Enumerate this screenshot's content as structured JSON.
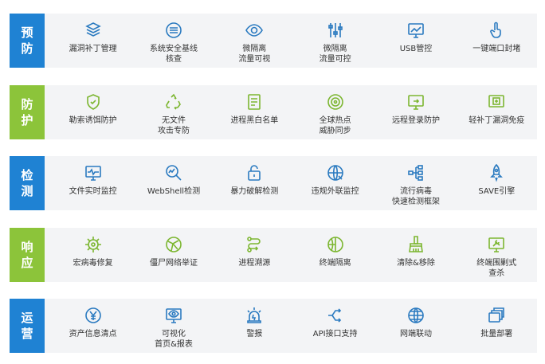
{
  "colors": {
    "blue": "#1f82d3",
    "green": "#8cc43a",
    "icon_blue": "#2a7ac0",
    "icon_green": "#7cb630",
    "text": "#333333"
  },
  "rows": [
    {
      "label": [
        "预",
        "防"
      ],
      "items": [
        {
          "icon": "layers-shield-icon",
          "lines": [
            "漏洞补丁管理"
          ]
        },
        {
          "icon": "server-list-icon",
          "lines": [
            "系统安全基线",
            "核查"
          ]
        },
        {
          "icon": "eye-icon",
          "lines": [
            "微隔离",
            "流量可视"
          ]
        },
        {
          "icon": "sliders-icon",
          "lines": [
            "微隔离",
            "流量可控"
          ]
        },
        {
          "icon": "monitor-chart-icon",
          "lines": [
            "USB管控"
          ]
        },
        {
          "icon": "hand-pointer-icon",
          "lines": [
            "一键端口封堵"
          ]
        }
      ]
    },
    {
      "label": [
        "防",
        "护"
      ],
      "items": [
        {
          "icon": "shield-check-icon",
          "lines": [
            "勒索诱饵防护"
          ]
        },
        {
          "icon": "recycle-icon",
          "lines": [
            "无文件",
            "攻击专防"
          ]
        },
        {
          "icon": "document-list-icon",
          "lines": [
            "进程黑白名单"
          ]
        },
        {
          "icon": "globe-target-icon",
          "lines": [
            "全球热点",
            "威胁同步"
          ]
        },
        {
          "icon": "remote-monitor-icon",
          "lines": [
            "远程登录防护"
          ]
        },
        {
          "icon": "patch-screen-icon",
          "lines": [
            "轻补丁漏洞免疫"
          ]
        }
      ]
    },
    {
      "label": [
        "检",
        "测"
      ],
      "items": [
        {
          "icon": "monitor-pulse-icon",
          "lines": [
            "文件实时监控"
          ]
        },
        {
          "icon": "search-chart-icon",
          "lines": [
            "WebShell检测"
          ]
        },
        {
          "icon": "padlock-icon",
          "lines": [
            "暴力破解检测"
          ]
        },
        {
          "icon": "globe-arrow-icon",
          "lines": [
            "违规外联监控"
          ]
        },
        {
          "icon": "network-tree-icon",
          "lines": [
            "流行病毒",
            "快速检测框架"
          ]
        },
        {
          "icon": "rocket-icon",
          "lines": [
            "SAVE引擎"
          ]
        }
      ]
    },
    {
      "label": [
        "响",
        "应"
      ],
      "items": [
        {
          "icon": "gear-bug-icon",
          "lines": [
            "宏病毒修复"
          ]
        },
        {
          "icon": "globe-network-icon",
          "lines": [
            "僵尸网络举证"
          ]
        },
        {
          "icon": "process-trace-icon",
          "lines": [
            "进程溯源"
          ]
        },
        {
          "icon": "globe-isolate-icon",
          "lines": [
            "终端隔离"
          ]
        },
        {
          "icon": "broom-icon",
          "lines": [
            "清除&移除"
          ]
        },
        {
          "icon": "monitor-tools-icon",
          "lines": [
            "终端围剿式",
            "查杀"
          ]
        }
      ]
    },
    {
      "label": [
        "运",
        "营"
      ],
      "items": [
        {
          "icon": "yen-coin-icon",
          "lines": [
            "资产信息清点"
          ]
        },
        {
          "icon": "monitor-eye-icon",
          "lines": [
            "可视化",
            "首页&报表"
          ]
        },
        {
          "icon": "alarm-light-icon",
          "lines": [
            "警报"
          ]
        },
        {
          "icon": "api-arrows-icon",
          "lines": [
            "API接口支持"
          ]
        },
        {
          "icon": "globe-link-icon",
          "lines": [
            "网端联动"
          ]
        },
        {
          "icon": "stacked-windows-icon",
          "lines": [
            "批量部署"
          ]
        }
      ]
    }
  ]
}
